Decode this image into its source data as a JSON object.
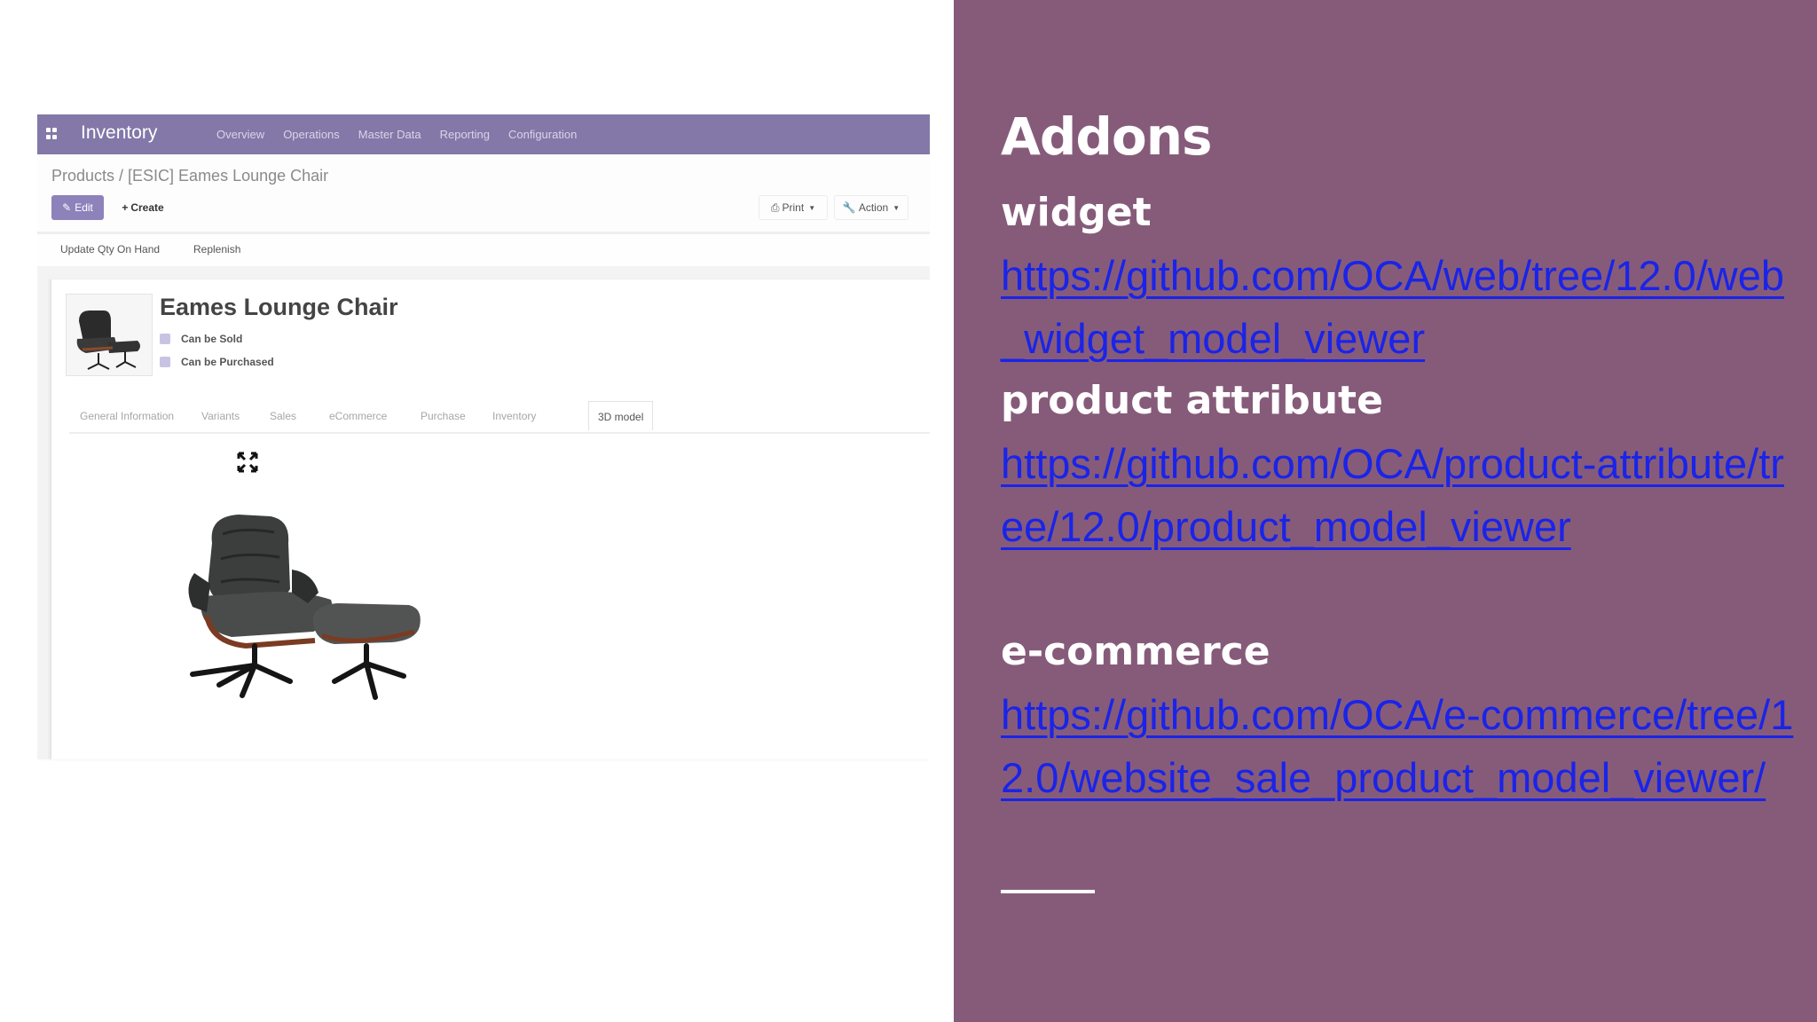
{
  "screenshot": {
    "app_name": "Inventory",
    "menu": [
      "Overview",
      "Operations",
      "Master Data",
      "Reporting",
      "Configuration"
    ],
    "breadcrumb": "Products / [ESIC] Eames Lounge Chair",
    "buttons": {
      "edit": "Edit",
      "create": "Create",
      "print": "Print",
      "action": "Action"
    },
    "status_buttons": [
      "Update Qty On Hand",
      "Replenish"
    ],
    "product": {
      "name": "Eames Lounge Chair",
      "can_be_sold": "Can be Sold",
      "can_be_purchased": "Can be Purchased"
    },
    "tabs": [
      "General Information",
      "Variants",
      "Sales",
      "eCommerce",
      "Purchase",
      "Inventory",
      "3D model"
    ],
    "active_tab": "3D model"
  },
  "slide": {
    "title": "Addons",
    "sections": [
      {
        "label": "widget",
        "url": "https://github.com/OCA/web/tree/12.0/web_widget_model_viewer"
      },
      {
        "label": "product attribute",
        "url": "https://github.com/OCA/product-attribute/tree/12.0/product_model_viewer"
      },
      {
        "label": "e-commerce",
        "url": "https://github.com/OCA/e-commerce/tree/12.0/website_sale_product_model_viewer/"
      }
    ]
  },
  "colors": {
    "panel_background": "#865b7a",
    "topbar": "#8378a8",
    "link": "#1a24e8",
    "edit_button": "#8e82bb"
  }
}
